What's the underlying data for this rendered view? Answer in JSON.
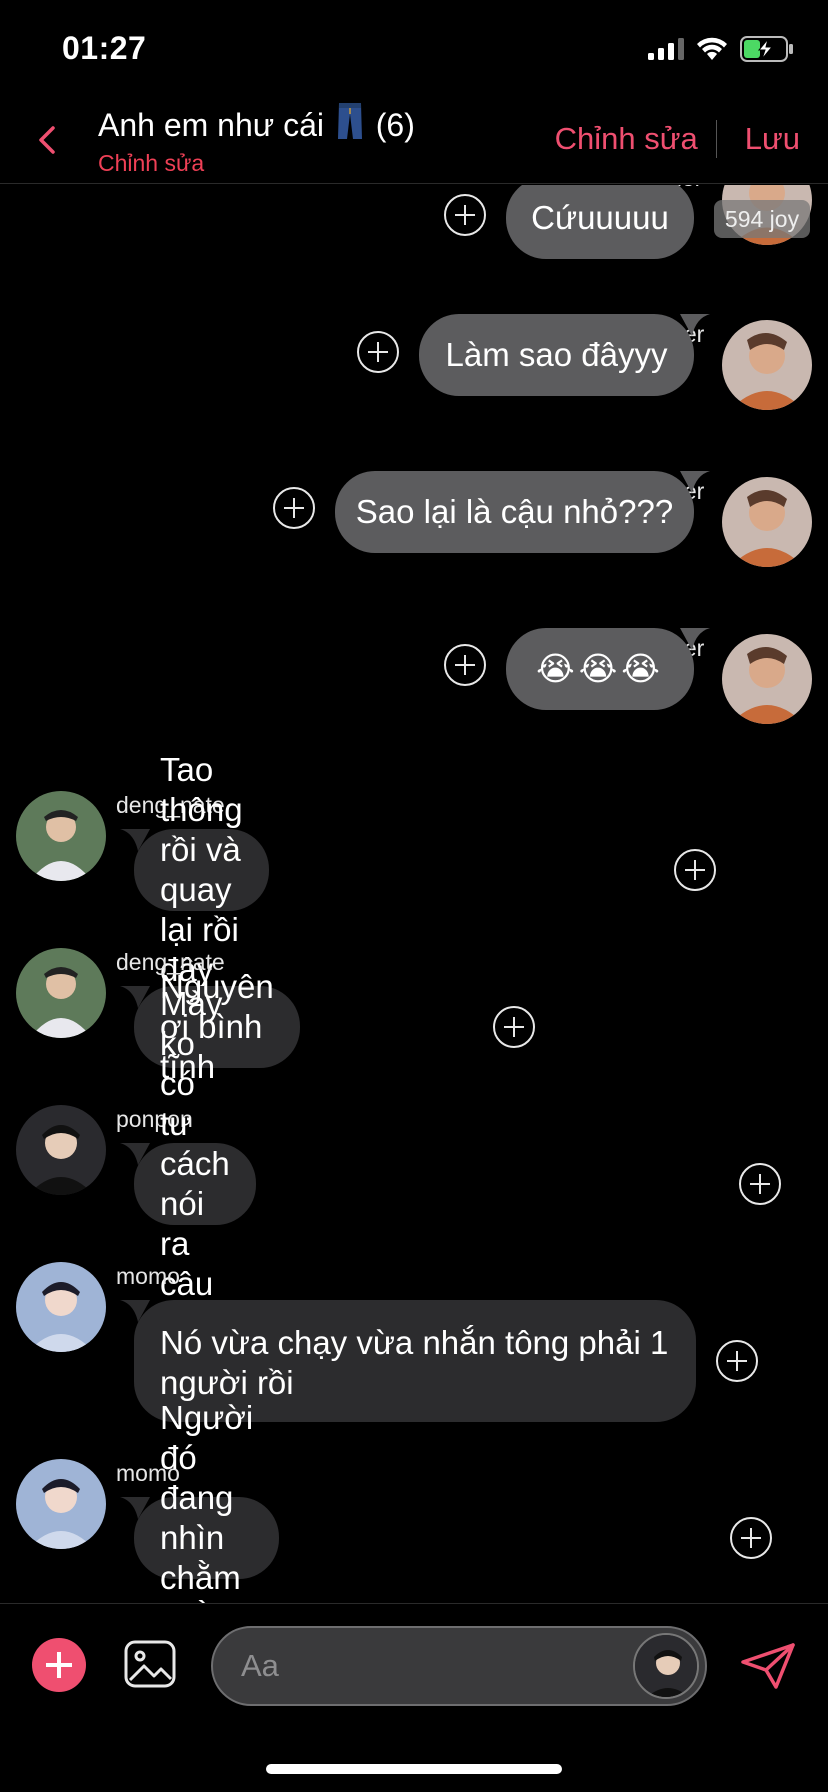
{
  "status": {
    "time": "01:27"
  },
  "nav": {
    "title_before": "Anh em như cái",
    "title_count": "(6)",
    "subtitle": "Chỉnh sửa",
    "edit_label": "Chỉnh sửa",
    "save_label": "Lưu"
  },
  "badge": {
    "label": "594 joy"
  },
  "messages": [
    {
      "user": "yuaner",
      "text": "Cứuuuuu",
      "side": "right"
    },
    {
      "user": "yuaner",
      "text": "Làm sao đâyyy",
      "side": "right"
    },
    {
      "user": "yuaner",
      "text": "Sao lại là cậu nhỏ???",
      "side": "right"
    },
    {
      "user": "yuaner",
      "text": "😭😭😭",
      "side": "right"
    },
    {
      "user": "deng_nate",
      "text": "Tao thông rồi và quay lại rồi đây",
      "side": "left"
    },
    {
      "user": "deng_nate",
      "text": "Nguyên ơi bình tĩnh",
      "side": "left"
    },
    {
      "user": "ponpon",
      "text": "Mày ko có tư cách nói ra câu này😒",
      "side": "left"
    },
    {
      "user": "momo",
      "text": "Nó vừa chạy vừa nhắn tông phải 1 người rồi",
      "side": "left"
    },
    {
      "user": "momo",
      "text": "Người đó đang nhìn chằm chằm nó",
      "side": "left"
    }
  ],
  "composer": {
    "placeholder": "Aa"
  },
  "colors": {
    "accent": "#ef4f70",
    "bubble_mine": "#5c5c5e",
    "bubble_theirs": "#2c2c2e"
  }
}
